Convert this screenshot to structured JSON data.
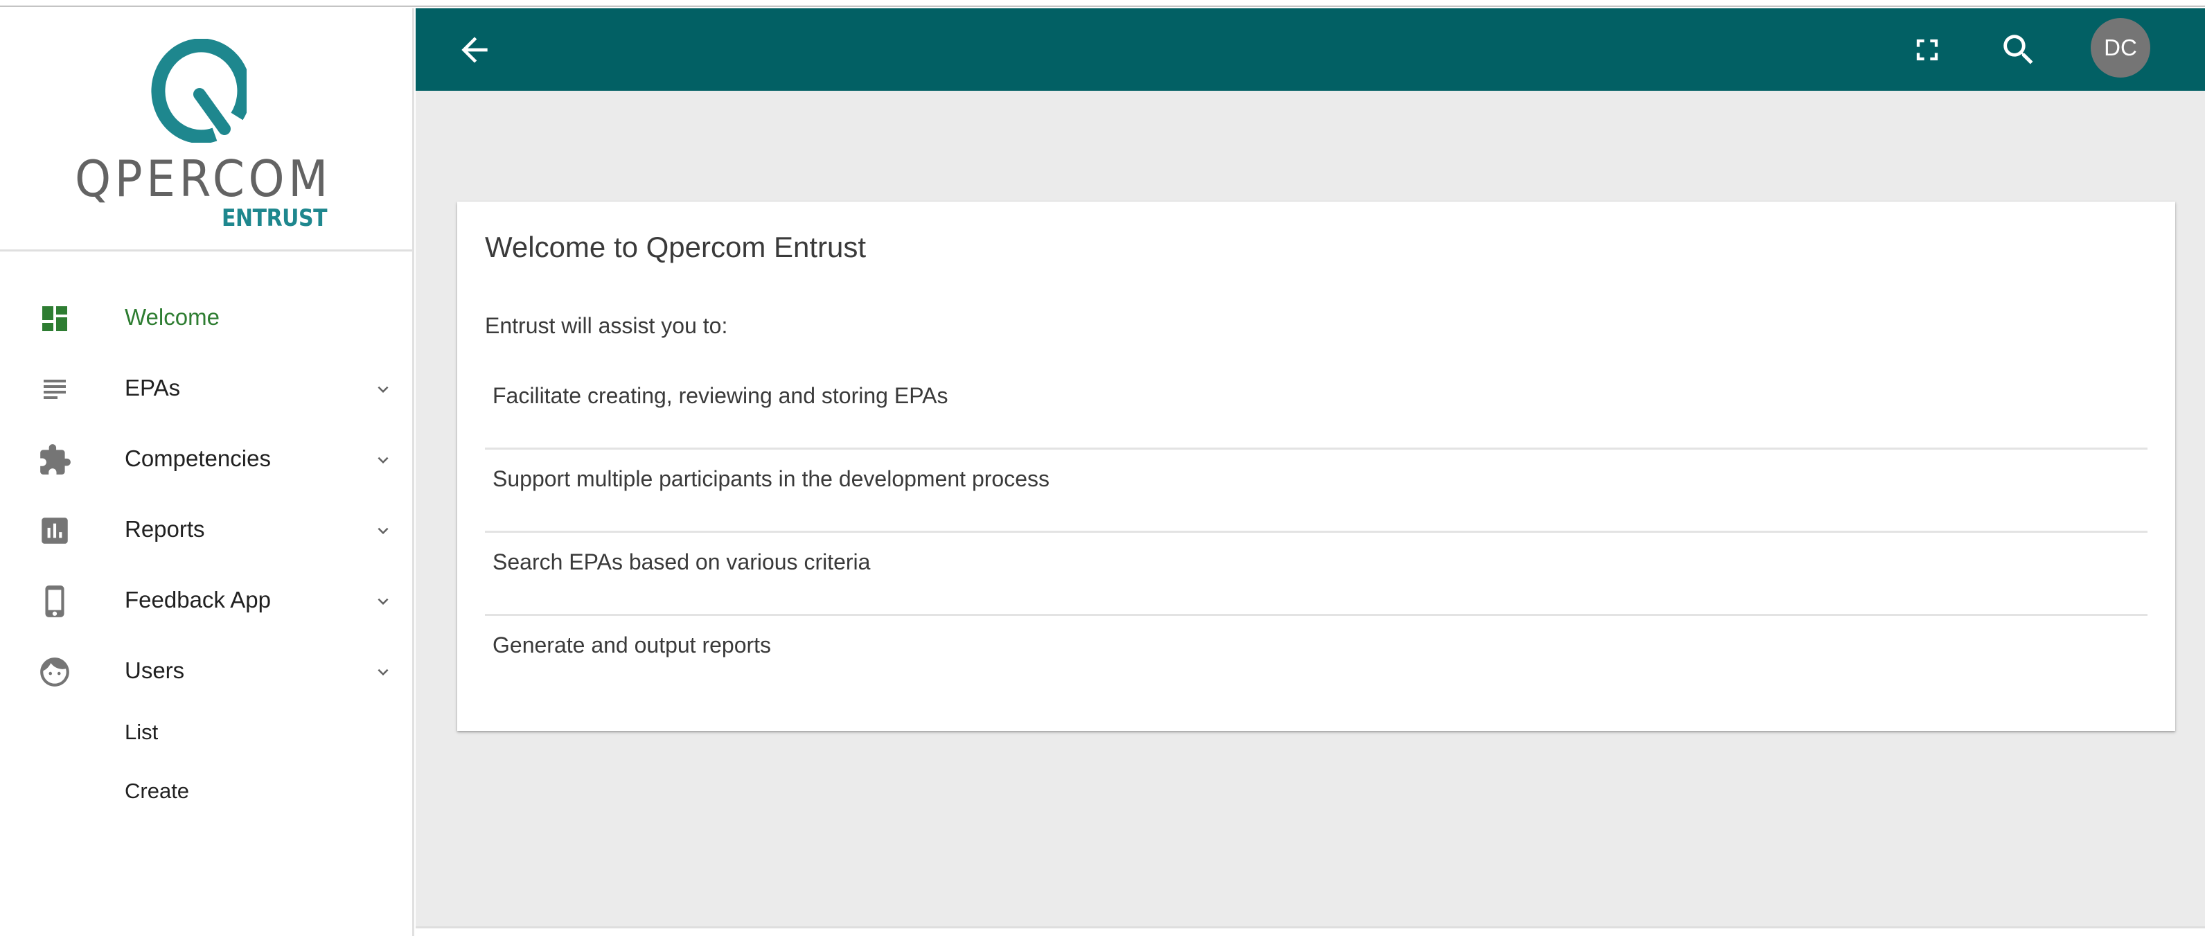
{
  "app": {
    "logo": {
      "wordmark": "QPERCOM",
      "subtitle": "ENTRUST",
      "q_color": "#1e878e",
      "wordmark_color": "#636363"
    },
    "colors": {
      "topbar": "#026064",
      "active": "#2e7d32",
      "icon": "#757575",
      "avatar": "#757575",
      "background": "#ebebeb"
    }
  },
  "topbar": {
    "back_icon": "arrow-left-icon",
    "fullscreen_icon": "fullscreen-icon",
    "search_icon": "search-icon",
    "avatar_initials": "DC"
  },
  "sidebar": {
    "items": [
      {
        "label": "Welcome",
        "icon": "dashboard-icon",
        "active": true,
        "expandable": false
      },
      {
        "label": "EPAs",
        "icon": "notes-icon",
        "active": false,
        "expandable": true
      },
      {
        "label": "Competencies",
        "icon": "puzzle-icon",
        "active": false,
        "expandable": true
      },
      {
        "label": "Reports",
        "icon": "bar-chart-icon",
        "active": false,
        "expandable": true
      },
      {
        "label": "Feedback App",
        "icon": "smartphone-icon",
        "active": false,
        "expandable": true
      },
      {
        "label": "Users",
        "icon": "face-icon",
        "active": false,
        "expandable": true,
        "expanded": true
      }
    ],
    "users_subitems": [
      {
        "label": "List"
      },
      {
        "label": "Create"
      }
    ]
  },
  "main": {
    "card": {
      "title": "Welcome to Qpercom Entrust",
      "intro": "Entrust will assist you to:",
      "features": [
        "Facilitate creating, reviewing and storing EPAs",
        "Support multiple participants in the development process",
        "Search EPAs based on various criteria",
        "Generate and output reports"
      ]
    }
  }
}
